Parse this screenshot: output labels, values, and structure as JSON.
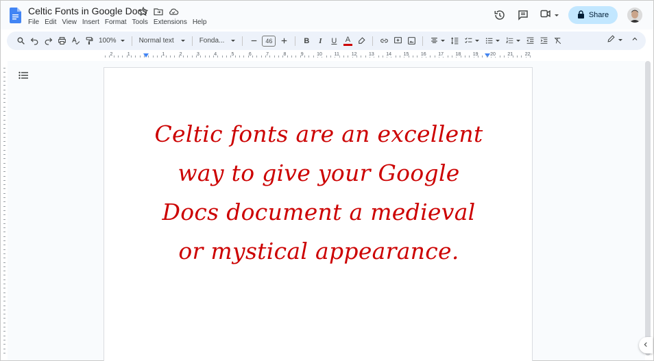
{
  "doc": {
    "title": "Celtic Fonts in Google Docs"
  },
  "menu": [
    "File",
    "Edit",
    "View",
    "Insert",
    "Format",
    "Tools",
    "Extensions",
    "Help"
  ],
  "share": {
    "label": "Share"
  },
  "toolbar": {
    "zoom": "100%",
    "style": "Normal text",
    "font": "Fonda...",
    "font_size": "46",
    "bold": "B",
    "italic": "I",
    "underline": "U",
    "text_color": "A"
  },
  "ruler": [
    "2",
    "1",
    "1",
    "2",
    "3",
    "4",
    "5",
    "6",
    "7",
    "8",
    "9",
    "10",
    "11",
    "12",
    "13",
    "14",
    "15",
    "16",
    "17",
    "18",
    "19",
    "20",
    "21",
    "22"
  ],
  "body": {
    "lines": [
      "Celtic fonts are an excellent",
      "way to give your Google",
      "Docs document a medieval",
      "or mystical appearance."
    ]
  },
  "colors": {
    "text": "#cc0000",
    "share_bg": "#c2e7ff",
    "toolbar_bg": "#edf2fa",
    "docs_blue": "#4285f4"
  },
  "icons": [
    "docs-logo-icon",
    "star-icon",
    "move-folder-icon",
    "cloud-status-icon",
    "history-icon",
    "comment-icon",
    "meet-icon",
    "lock-icon",
    "search-icon",
    "undo-icon",
    "redo-icon",
    "print-icon",
    "spellcheck-icon",
    "paint-format-icon",
    "highlight-icon",
    "link-icon",
    "add-comment-icon",
    "insert-image-icon",
    "align-icon",
    "line-spacing-icon",
    "checklist-icon",
    "bulleted-list-icon",
    "numbered-list-icon",
    "decrease-indent-icon",
    "increase-indent-icon",
    "clear-formatting-icon",
    "editing-mode-icon",
    "collapse-toolbar-icon",
    "outline-icon",
    "side-panel-toggle-icon"
  ]
}
